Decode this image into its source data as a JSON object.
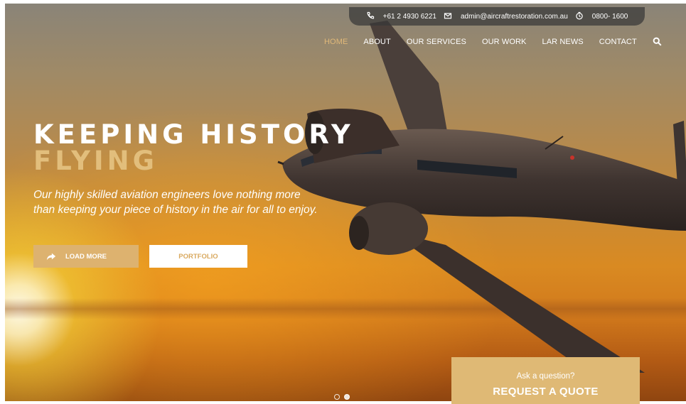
{
  "contact_bar": {
    "phone": "+61 2 4930 6221",
    "email": "admin@aircraftrestoration.com.au",
    "hours": "0800- 1600",
    "icons": [
      "phone-icon",
      "email-icon",
      "clock-icon"
    ]
  },
  "nav": {
    "items": [
      {
        "label": "HOME",
        "active": true
      },
      {
        "label": "ABOUT",
        "active": false
      },
      {
        "label": "OUR SERVICES",
        "active": false
      },
      {
        "label": "OUR WORK",
        "active": false
      },
      {
        "label": "LAR NEWS",
        "active": false
      },
      {
        "label": "CONTACT",
        "active": false
      }
    ],
    "search_icon": "search-icon"
  },
  "hero": {
    "headline_line1": "KEEPING HISTORY",
    "headline_line2": "FLYING",
    "tagline": "Our highly skilled aviation engineers love nothing more than keeping your piece of history in the air for all to enjoy.",
    "load_more_label": "LOAD MORE",
    "portfolio_label": "PORTFOLIO"
  },
  "slider": {
    "count": 2,
    "active_index": 1
  },
  "quote": {
    "prompt": "Ask a question?",
    "cta": "REQUEST A QUOTE"
  },
  "colors": {
    "accent_gold": "#ddb26f",
    "active_nav": "#e0b878",
    "headline_gold": "#e2be7c"
  }
}
